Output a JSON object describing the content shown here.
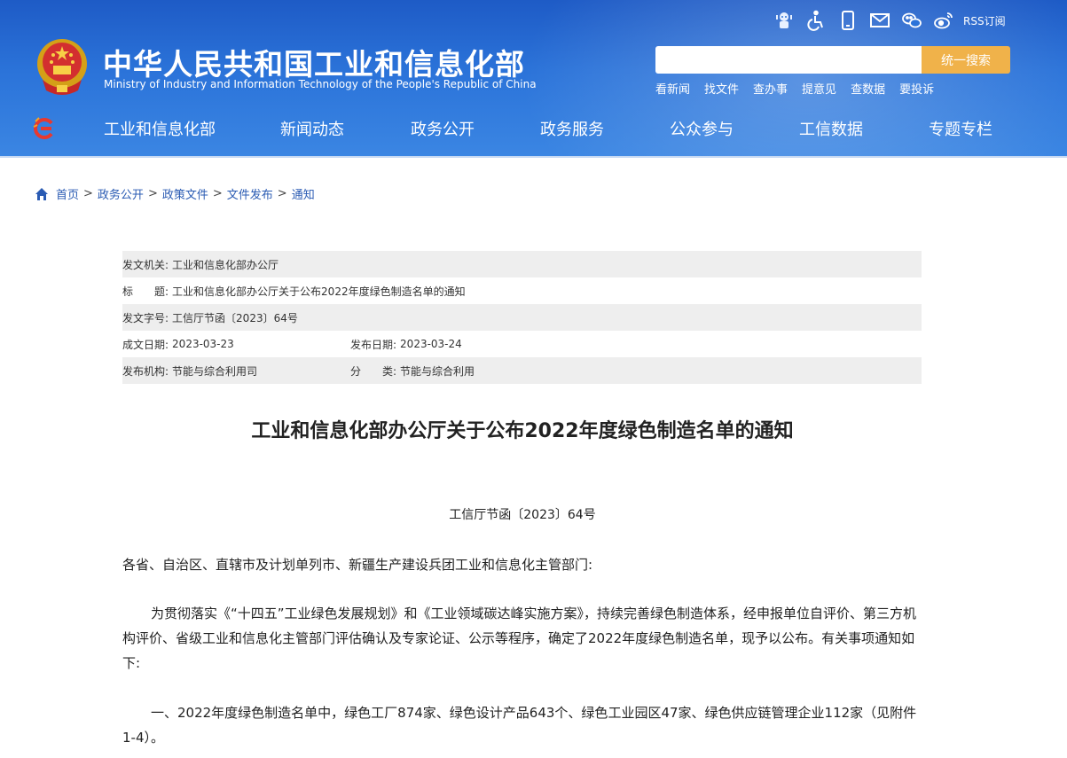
{
  "header": {
    "site_title": "中华人民共和国工业和信息化部",
    "site_subtitle": "Ministry of Industry and Information Technology of the People's Republic of China",
    "utility_icons": [
      "ai-assistant-icon",
      "accessibility-icon",
      "mobile-icon",
      "mail-icon",
      "wechat-icon",
      "weibo-icon"
    ],
    "rss_label": "RSS订阅",
    "search": {
      "placeholder": "",
      "button_label": "统一搜索"
    },
    "quick_links": [
      "看新闻",
      "找文件",
      "查办事",
      "提意见",
      "查数据",
      "要投诉"
    ],
    "nav_items": [
      "工业和信息化部",
      "新闻动态",
      "政务公开",
      "政务服务",
      "公众参与",
      "工信数据",
      "专题专栏"
    ]
  },
  "breadcrumb": [
    "首页",
    "政务公开",
    "政策文件",
    "文件发布",
    "通知"
  ],
  "meta": {
    "issuer_label": "发文机关:",
    "issuer": "工业和信息化部办公厅",
    "title_label": "标　　题:",
    "title": "工业和信息化部办公厅关于公布2022年度绿色制造名单的通知",
    "doc_no_label": "发文字号:",
    "doc_no": "工信厅节函〔2023〕64号",
    "created_label": "成文日期:",
    "created": "2023-03-23",
    "published_label": "发布日期:",
    "published": "2023-03-24",
    "org_label": "发布机构:",
    "org": "节能与综合利用司",
    "category_label": "分　　类:",
    "category": "节能与综合利用"
  },
  "article": {
    "title": "工业和信息化部办公厅关于公布2022年度绿色制造名单的通知",
    "doc_number": "工信厅节函〔2023〕64号",
    "addressee": "各省、自治区、直辖市及计划单列市、新疆生产建设兵团工业和信息化主管部门:",
    "paragraph1": "为贯彻落实《“十四五”工业绿色发展规划》和《工业领域碳达峰实施方案》，持续完善绿色制造体系，经申报单位自评价、第三方机构评价、省级工业和信息化主管部门评估确认及专家论证、公示等程序，确定了2022年度绿色制造名单，现予以公布。有关事项通知如下:",
    "paragraph2": "一、2022年度绿色制造名单中，绿色工厂874家、绿色设计产品643个、绿色工业园区47家、绿色供应链管理企业112家（见附件1-4）。"
  },
  "colors": {
    "header_blue": "#2b73d9",
    "search_button": "#f0b24a",
    "meta_shade": "#eeeeee",
    "link_blue": "#2a5bb3"
  }
}
